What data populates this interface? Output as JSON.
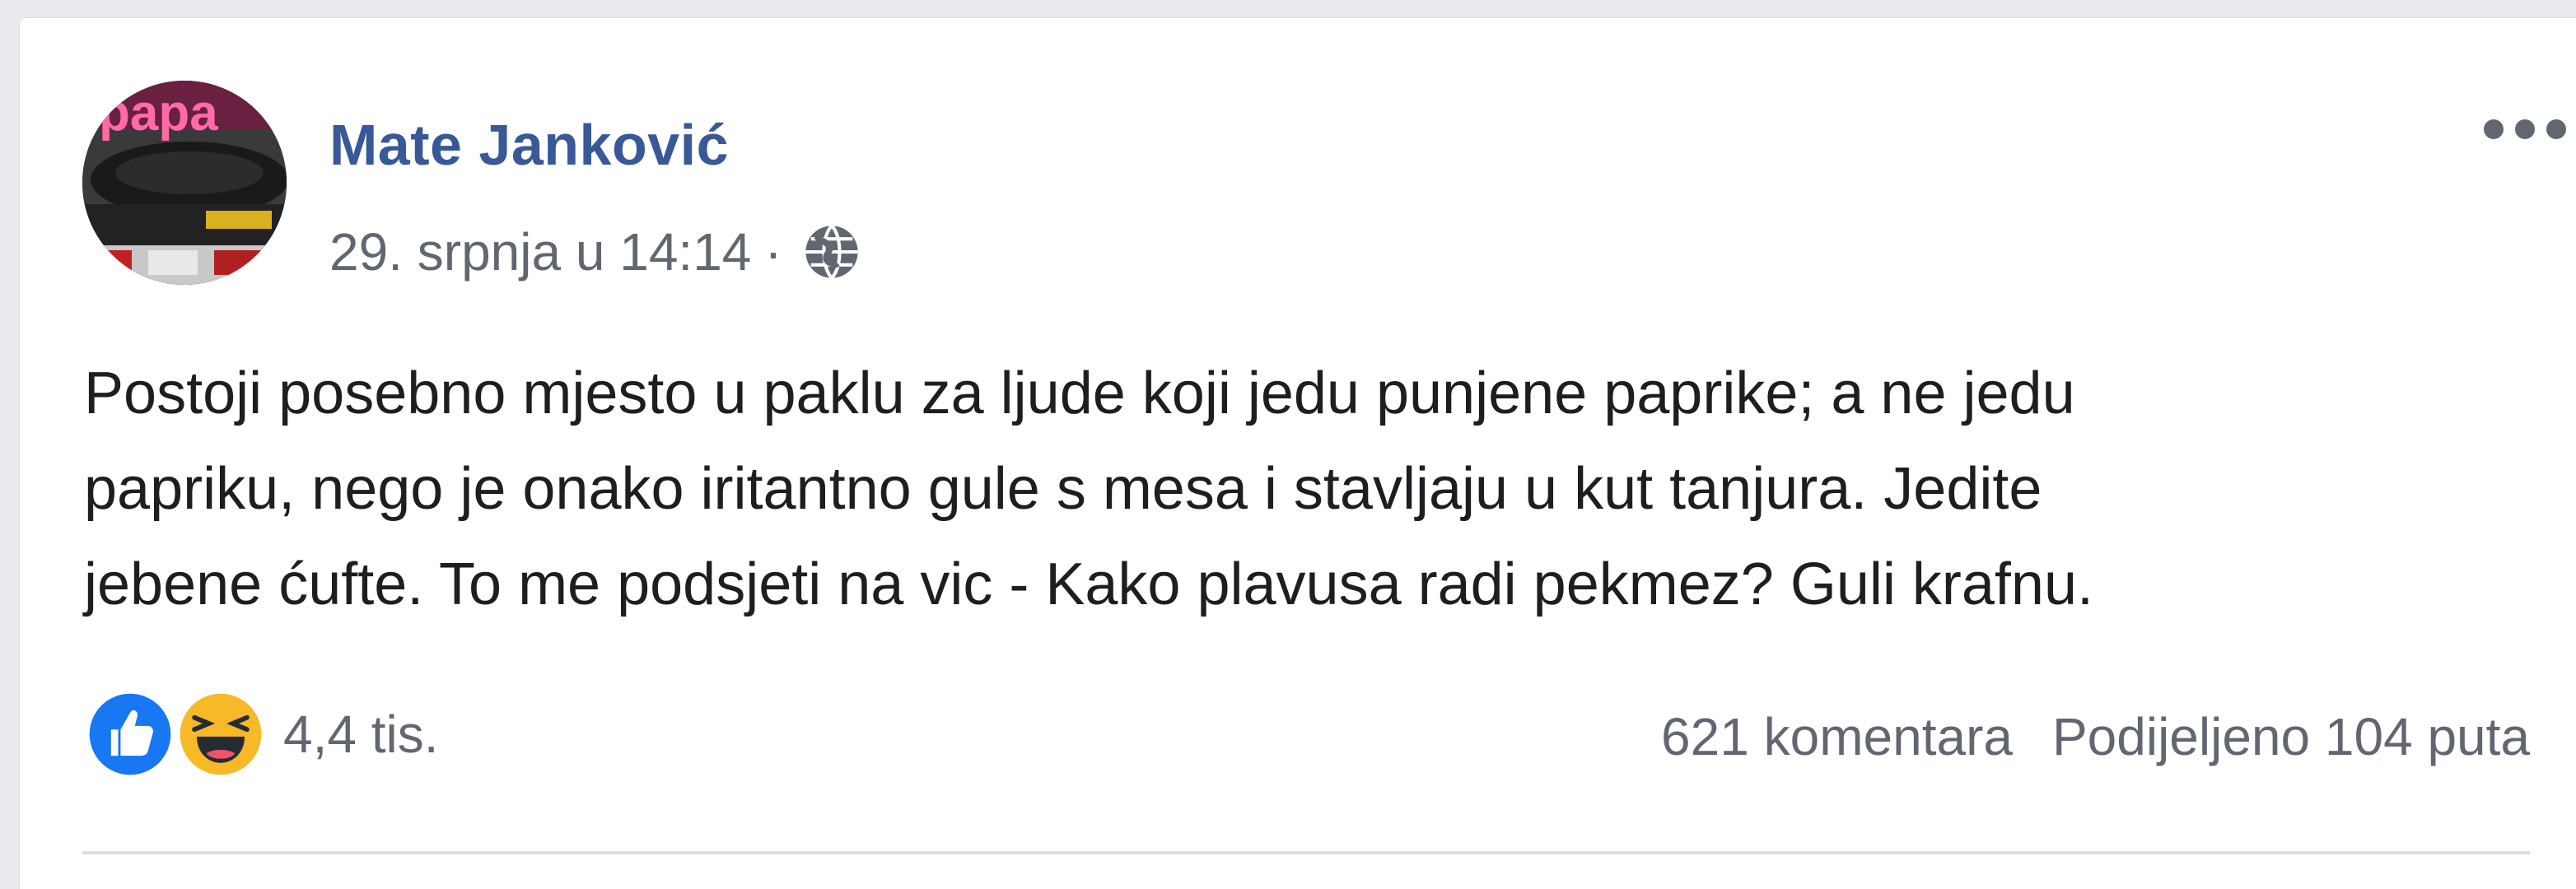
{
  "post": {
    "author_name": "Mate Janković",
    "timestamp": "29. srpnja u 14:14",
    "separator": "·",
    "privacy_icon": "globe-icon",
    "more_icon": "more-horizontal-icon",
    "text": "Postoji posebno mjesto u paklu za ljude koji jedu punjene paprike; a ne jedu\npapriku, nego je onako iritantno gule s mesa i stavljaju u kut tanjura. Jedite\njebene ćufte. To me podsjeti na vic - Kako plavusa radi pekmez? Guli krafnu."
  },
  "reactions": {
    "icons": [
      "like-icon",
      "haha-icon"
    ],
    "count": "4,4 tis."
  },
  "stats": {
    "comments": "621 komentara",
    "shares": "Podijeljeno 104 puta"
  },
  "colors": {
    "author": "#385898",
    "meta": "#616770",
    "text": "#1c1e21",
    "like_blue": "#1877f2",
    "haha_yellow": "#f7b928"
  }
}
